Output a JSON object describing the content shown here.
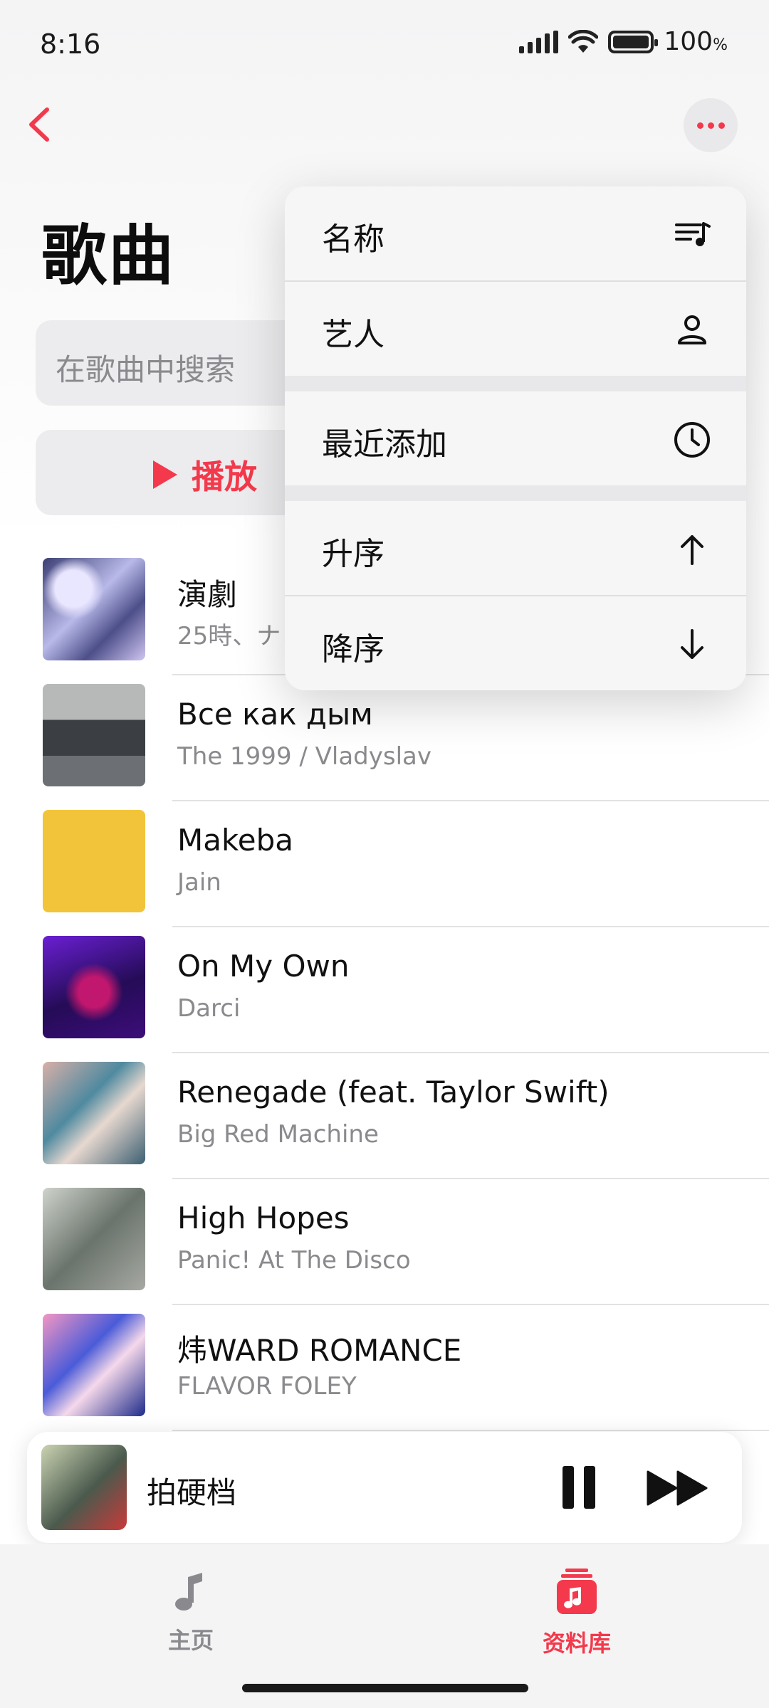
{
  "status_bar": {
    "time": "8:16",
    "battery": "100",
    "battery_unit": "%"
  },
  "header": {
    "title": "歌曲"
  },
  "search": {
    "placeholder": "在歌曲中搜索"
  },
  "actions": {
    "play_label": "播放"
  },
  "songs": [
    {
      "title": "演劇",
      "artist": "25時、ナ"
    },
    {
      "title": "Все как дым",
      "artist": "The 1999 / Vladyslav"
    },
    {
      "title": "Makeba",
      "artist": "Jain"
    },
    {
      "title": "On My Own",
      "artist": "Darci"
    },
    {
      "title": "Renegade (feat. Taylor Swift)",
      "artist": "Big Red Machine"
    },
    {
      "title": "High Hopes",
      "artist": "Panic! At The Disco"
    },
    {
      "title": "炜WARD ROMANCE",
      "artist": "FLAVOR FOLEY"
    }
  ],
  "sort_menu": {
    "items": [
      {
        "label": "名称",
        "icon": "sort-list-icon"
      },
      {
        "label": "艺人",
        "icon": "person-icon"
      },
      {
        "label": "最近添加",
        "icon": "clock-icon"
      },
      {
        "label": "升序",
        "icon": "arrow-up-icon"
      },
      {
        "label": "降序",
        "icon": "arrow-down-icon"
      }
    ]
  },
  "now_playing": {
    "title": "拍硬档"
  },
  "tabs": [
    {
      "label": "主页",
      "icon": "music-note-icon"
    },
    {
      "label": "资料库",
      "icon": "library-icon",
      "active": true
    }
  ],
  "colors": {
    "accent": "#f3394b",
    "text_secondary": "#8a8a8e"
  }
}
